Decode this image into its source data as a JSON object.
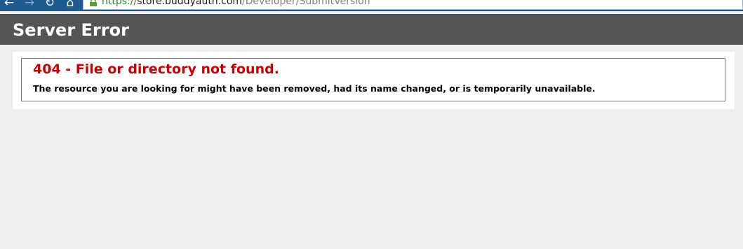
{
  "browser": {
    "icons": {
      "back": "back-arrow-icon",
      "forward": "forward-arrow-icon",
      "reload": "reload-icon",
      "home": "home-icon",
      "lock": "lock-icon"
    },
    "glyphs": {
      "back": "←",
      "forward": "→",
      "reload": "↻",
      "home": "⌂"
    },
    "url": {
      "scheme": "https://",
      "domain": "store.buddyauth.com",
      "path": "/Developer/SubmitVersion"
    }
  },
  "header": {
    "title": "Server Error"
  },
  "error": {
    "heading": "404 - File or directory not found.",
    "message": "The resource you are looking for might have been removed, had its name changed, or is temporarily unavailable."
  },
  "colors": {
    "chrome": "#1e5b8e",
    "header_bar": "#555555",
    "error_heading": "#cc0000",
    "page_background": "#eeeeee",
    "url_scheme": "#2a8c2a"
  }
}
